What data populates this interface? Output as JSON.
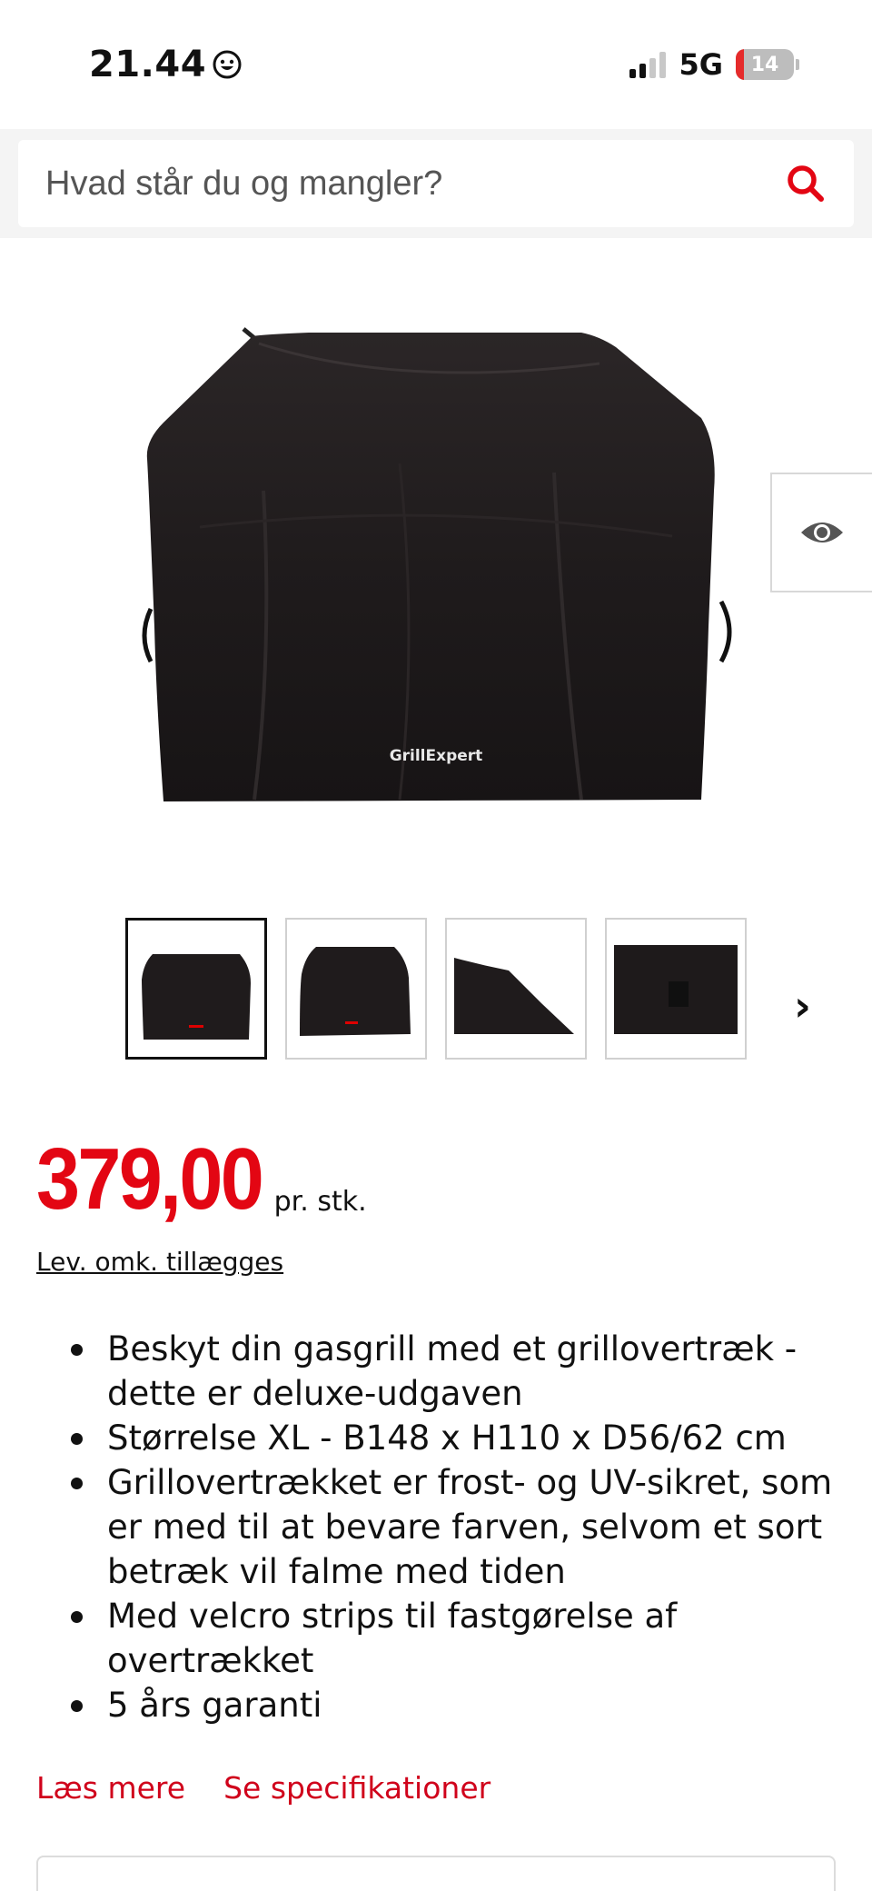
{
  "status_bar": {
    "time": "21.44",
    "network": "5G",
    "battery": "14"
  },
  "search": {
    "placeholder": "Hvad står du og mangler?"
  },
  "product": {
    "logo_text": "GrillExpert",
    "price": "379,00",
    "unit": "pr. stk.",
    "shipping_note": "Lev. omk. tillægges",
    "features": [
      "Beskyt din gasgrill med et grillovertræk - dette er deluxe-udgaven",
      "Størrelse XL - B148 x H110 x D56/62 cm",
      "Grillovertrækket er frost- og UV-sikret, som er med til at bevare farven, selvom et sort betræk vil falme med tiden",
      "Med velcro strips til fastgørelse af overtrækket",
      "5 års garanti"
    ]
  },
  "links": {
    "read_more": "Læs mere",
    "specs": "Se specifikationer"
  },
  "colors": {
    "accent": "#e30613",
    "link": "#d0021b"
  }
}
